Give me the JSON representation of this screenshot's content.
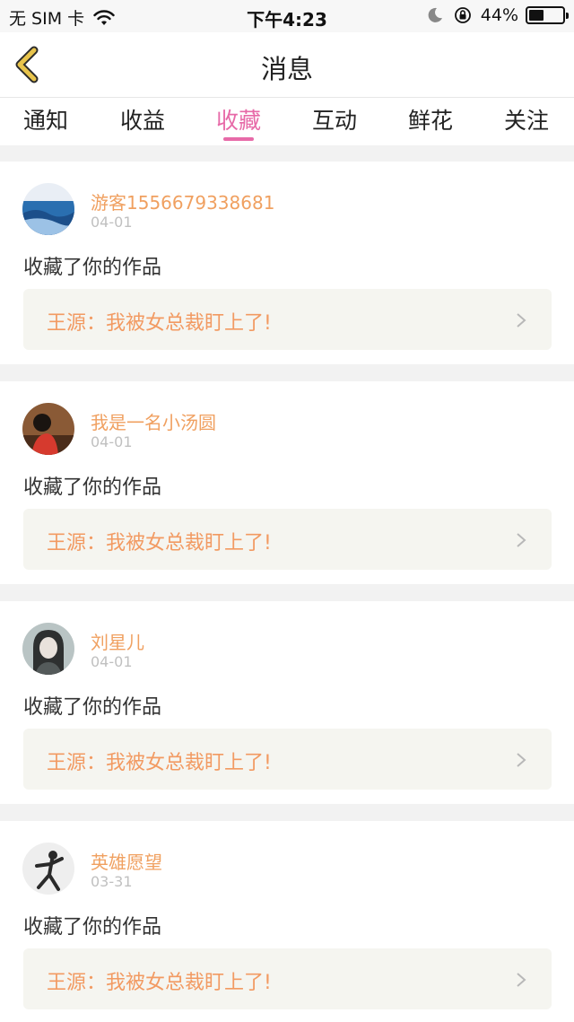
{
  "status_bar": {
    "carrier": "无 SIM 卡",
    "time": "下午4:23",
    "battery": "44%",
    "battery_level": 0.44,
    "icons": [
      "wifi-icon",
      "moon-icon",
      "rotation-lock-icon",
      "battery-icon"
    ]
  },
  "header": {
    "title": "消息",
    "back_icon": "chevron-left-icon"
  },
  "tabs": [
    {
      "label": "通知",
      "active": false
    },
    {
      "label": "收益",
      "active": false
    },
    {
      "label": "收藏",
      "active": true
    },
    {
      "label": "互动",
      "active": false
    },
    {
      "label": "鲜花",
      "active": false
    },
    {
      "label": "关注",
      "active": false
    }
  ],
  "messages": [
    {
      "username": "游客1556679338681",
      "date": "04-01",
      "action": "收藏了你的作品",
      "work": "王源：我被女总裁盯上了!"
    },
    {
      "username": "我是一名小汤圆",
      "date": "04-01",
      "action": "收藏了你的作品",
      "work": "王源：我被女总裁盯上了!"
    },
    {
      "username": "刘星儿",
      "date": "04-01",
      "action": "收藏了你的作品",
      "work": "王源：我被女总裁盯上了!"
    },
    {
      "username": "英雄愿望",
      "date": "03-31",
      "action": "收藏了你的作品",
      "work": "王源：我被女总裁盯上了!"
    }
  ],
  "colors": {
    "accent": "#e76aa8",
    "username": "#f0a060",
    "work_title": "#f29a62",
    "back_arrow": "#e8c44c"
  }
}
